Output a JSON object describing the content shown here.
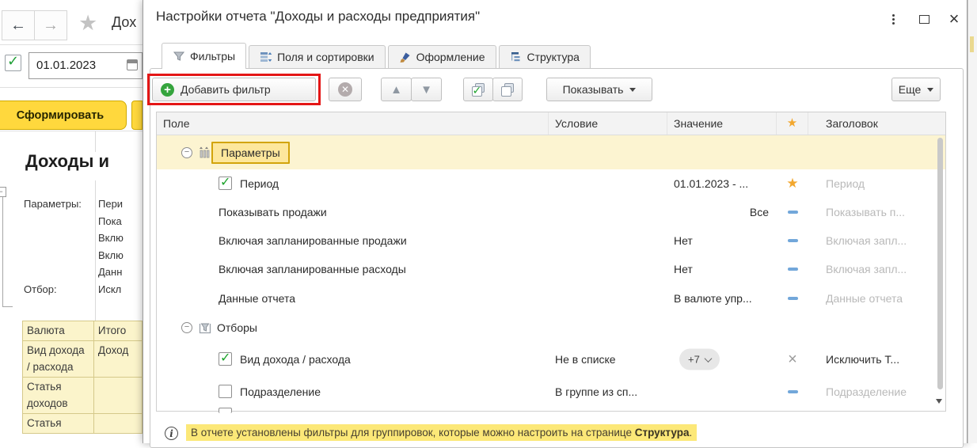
{
  "bg_window": {
    "nav_back_icon": "←",
    "nav_forward_icon": "→",
    "nav_star_icon": "★",
    "title_fragment": "Дох",
    "period_value": "01.01.2023",
    "generate_label": "Сформировать",
    "report_heading": "Доходы и",
    "report_lines": [
      {
        "label": "Параметры:",
        "value": "Пери"
      },
      {
        "label": "",
        "value": "Пока"
      },
      {
        "label": "",
        "value": "Вклю"
      },
      {
        "label": "",
        "value": "Вклю"
      },
      {
        "label": "",
        "value": "Данн"
      },
      {
        "label": "Отбор:",
        "value": "Искл"
      }
    ],
    "grid_rows": [
      {
        "c1": "Валюта",
        "c2": "Итого"
      },
      {
        "c1": "Вид дохода / расхода",
        "c2": "Доход"
      },
      {
        "c1": "Статья доходов",
        "c2": ""
      },
      {
        "c1": "Статья",
        "c2": ""
      }
    ]
  },
  "dialog": {
    "title": "Настройки отчета \"Доходы и расходы предприятия\"",
    "window_controls": {
      "menu_icon": "⋮",
      "maximize_icon": "▭",
      "close_icon": "×"
    },
    "tabs": [
      {
        "label": "Фильтры",
        "icon": "filter-funnel",
        "active": true
      },
      {
        "label": "Поля и сортировки",
        "icon": "fields-sort",
        "active": false
      },
      {
        "label": "Оформление",
        "icon": "paint-brush",
        "active": false
      },
      {
        "label": "Структура",
        "icon": "structure-tree",
        "active": false
      }
    ],
    "toolbar": {
      "add_filter_label": "Добавить фильтр",
      "show_label": "Показывать",
      "more_label": "Еще"
    },
    "annotation_color": "#e41616",
    "table": {
      "headers": {
        "field": "Поле",
        "condition": "Условие",
        "value": "Значение",
        "quick_access": "★",
        "header": "Заголовок"
      },
      "rows": [
        {
          "kind": "group",
          "icon": "parameters",
          "label": "Параметры",
          "selected": true
        },
        {
          "kind": "item",
          "checkbox": "checked",
          "field": "Период",
          "condition": "",
          "value": "01.01.2023 - ...",
          "marker": "star",
          "header": "Период",
          "header_dim": true
        },
        {
          "kind": "item",
          "checkbox": "none",
          "field": "Показывать продажи",
          "condition": "",
          "value": "Все",
          "value_align": "right",
          "marker": "dash",
          "header": "Показывать п...",
          "header_dim": true
        },
        {
          "kind": "item",
          "checkbox": "none",
          "field": "Включая запланированные продажи",
          "condition": "",
          "value": "Нет",
          "marker": "dash",
          "header": "Включая запл...",
          "header_dim": true
        },
        {
          "kind": "item",
          "checkbox": "none",
          "field": "Включая запланированные расходы",
          "condition": "",
          "value": "Нет",
          "marker": "dash",
          "header": "Включая запл...",
          "header_dim": true
        },
        {
          "kind": "item",
          "checkbox": "none",
          "field": "Данные отчета",
          "condition": "",
          "value": "В валюте упр...",
          "marker": "dash",
          "header": "Данные отчета",
          "header_dim": true
        },
        {
          "kind": "group",
          "icon": "filter-box",
          "label": "Отборы",
          "selected": false
        },
        {
          "kind": "item",
          "checkbox": "checked",
          "field": "Вид дохода / расхода",
          "condition": "Не в списке",
          "pill": "+7",
          "marker": "x",
          "header": "Исключить Т...",
          "header_dim": false
        },
        {
          "kind": "item",
          "checkbox": "unchecked",
          "field": "Подразделение",
          "condition": "В группе из сп...",
          "value": "",
          "marker": "dash",
          "header": "Подразделение",
          "header_dim": true
        },
        {
          "kind": "partial"
        }
      ]
    },
    "info": {
      "text_before": "В отчете установлены фильтры для группировок, которые можно настроить на странице ",
      "text_bold": "Структура",
      "text_after": "."
    }
  }
}
